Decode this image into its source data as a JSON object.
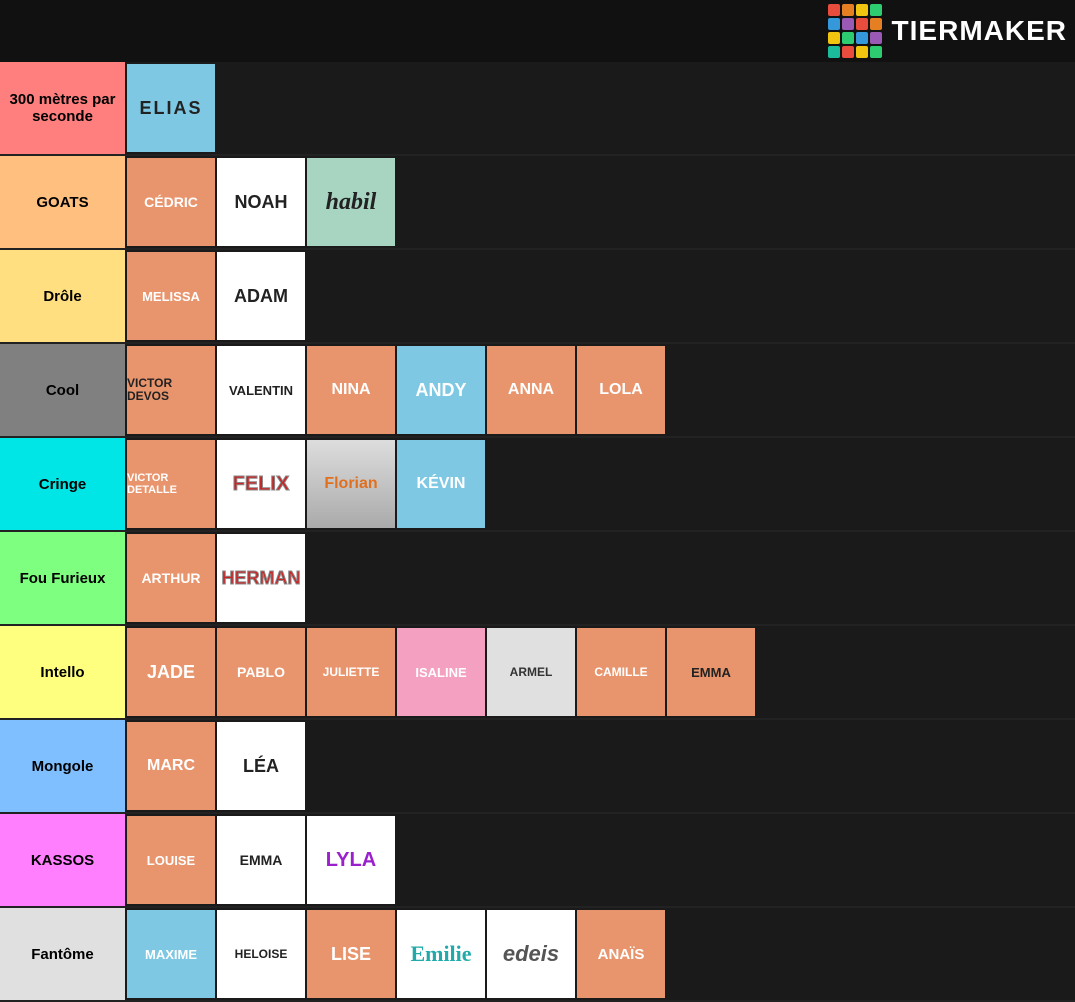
{
  "logo": {
    "text": "TiERMAKER",
    "colors": [
      "#e74c3c",
      "#e67e22",
      "#f1c40f",
      "#2ecc71",
      "#3498db",
      "#9b59b6",
      "#1abc9c",
      "#e74c3c",
      "#e67e22",
      "#f1c40f",
      "#2ecc71",
      "#3498db",
      "#9b59b6",
      "#1abc9c",
      "#e74c3c",
      "#e67e22"
    ]
  },
  "tiers": [
    {
      "id": "row-300",
      "label": "300 mètres par seconde",
      "bg": "#ff7f7f",
      "items": [
        {
          "id": "elias",
          "text": "ELIAS",
          "style": "style-elias"
        }
      ]
    },
    {
      "id": "row-goats",
      "label": "GOATS",
      "bg": "#ffbf7f",
      "items": [
        {
          "id": "cedric",
          "text": "CÉDRIC",
          "style": "style-cedric"
        },
        {
          "id": "noah",
          "text": "NOAH",
          "style": "style-noah"
        },
        {
          "id": "habilete",
          "text": "habil",
          "style": "style-habilete"
        }
      ]
    },
    {
      "id": "row-drole",
      "label": "Drôle",
      "bg": "#ffdf7f",
      "items": [
        {
          "id": "melissa",
          "text": "MELISSA",
          "style": "style-melissa"
        },
        {
          "id": "adam",
          "text": "ADAM",
          "style": "style-adam"
        }
      ]
    },
    {
      "id": "row-cool",
      "label": "Cool",
      "bg": "#808080",
      "items": [
        {
          "id": "victordevos",
          "text": "VICTOR DEVOS",
          "style": "style-victordevos"
        },
        {
          "id": "valentin",
          "text": "VALENTIN",
          "style": "style-valentin"
        },
        {
          "id": "nina",
          "text": "NINA",
          "style": "style-nina"
        },
        {
          "id": "andy",
          "text": "ANDY",
          "style": "style-andy"
        },
        {
          "id": "anna",
          "text": "ANNA",
          "style": "style-anna"
        },
        {
          "id": "lola",
          "text": "LOLA",
          "style": "style-lola"
        }
      ]
    },
    {
      "id": "row-cringe",
      "label": "Cringe",
      "bg": "#00e5e5",
      "items": [
        {
          "id": "victordetalle",
          "text": "VICTOR DETALLE",
          "style": "style-victordetalle"
        },
        {
          "id": "felix",
          "text": "FELIX",
          "style": "style-felix"
        },
        {
          "id": "florian",
          "text": "Florian",
          "style": "style-florian"
        },
        {
          "id": "kevin",
          "text": "KÉVIN",
          "style": "style-kevin"
        }
      ]
    },
    {
      "id": "row-fou",
      "label": "Fou Furieux",
      "bg": "#7fff7f",
      "items": [
        {
          "id": "arthur",
          "text": "ARTHUR",
          "style": "style-arthur"
        },
        {
          "id": "herman",
          "text": "HERMAN",
          "style": "style-herman"
        }
      ]
    },
    {
      "id": "row-intello",
      "label": "Intello",
      "bg": "#ffff7f",
      "items": [
        {
          "id": "jade",
          "text": "JADE",
          "style": "style-jade"
        },
        {
          "id": "pablo",
          "text": "PABLO",
          "style": "style-pablo"
        },
        {
          "id": "juliette",
          "text": "JULIETTE",
          "style": "style-juliette"
        },
        {
          "id": "isaline",
          "text": "ISALINE",
          "style": "style-isaline"
        },
        {
          "id": "armel",
          "text": "ARMEL",
          "style": "style-armel"
        },
        {
          "id": "camille",
          "text": "CAMILLE",
          "style": "style-camille"
        },
        {
          "id": "emma-intello",
          "text": "EMMA",
          "style": "style-emma-intello"
        }
      ]
    },
    {
      "id": "row-mongole",
      "label": "Mongole",
      "bg": "#7fbfff",
      "items": [
        {
          "id": "marc",
          "text": "MARC",
          "style": "style-marc"
        },
        {
          "id": "lea",
          "text": "LÉA",
          "style": "style-lea"
        }
      ]
    },
    {
      "id": "row-kassos",
      "label": "KASSOS",
      "bg": "#ff7fff",
      "items": [
        {
          "id": "louise",
          "text": "LOUISE",
          "style": "style-louise"
        },
        {
          "id": "emma-kassos",
          "text": "EMMA",
          "style": "style-emma-kassos"
        },
        {
          "id": "lyla",
          "text": "LYLA",
          "style": "style-lyla"
        }
      ]
    },
    {
      "id": "row-fantome",
      "label": "Fantôme",
      "bg": "#e0e0e0",
      "items": [
        {
          "id": "maxime",
          "text": "MAXIME",
          "style": "style-maxime"
        },
        {
          "id": "heloise",
          "text": "HELOISE",
          "style": "style-heloise"
        },
        {
          "id": "lise",
          "text": "LISE",
          "style": "style-lise"
        },
        {
          "id": "emilie",
          "text": "Emilie",
          "style": "style-emilie"
        },
        {
          "id": "edeis",
          "text": "edeis",
          "style": "style-edeis"
        },
        {
          "id": "anais",
          "text": "ANAÏS",
          "style": "style-anais"
        }
      ]
    }
  ]
}
